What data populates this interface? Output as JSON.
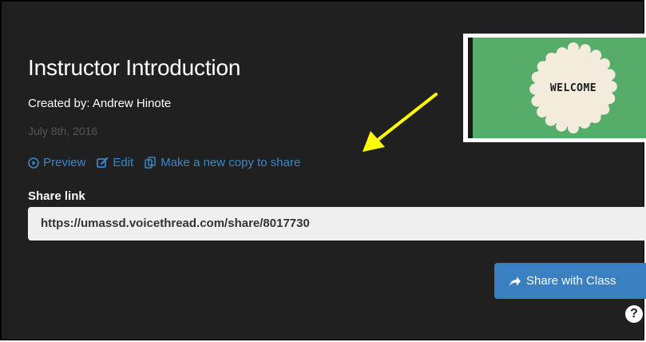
{
  "voicethread": {
    "title": "Instructor Introduction",
    "created_by": "Created by: Andrew Hinote",
    "date": "July 8th, 2016",
    "actions": {
      "preview": "Preview",
      "edit": "Edit",
      "copy": "Make a new copy to share"
    },
    "share_link_label": "Share link",
    "share_link_value": "https://umassd.voicethread.com/share/8017730",
    "share_button": "Share with Class",
    "help_icon": "?",
    "thumbnail_text": "WELCOME"
  },
  "colors": {
    "panel_bg": "#202020",
    "link": "#3a87c8",
    "button": "#3a7fc0",
    "thumbnail_bg": "#56ad6a",
    "badge": "#f3ecdc",
    "arrow": "#ffff00"
  },
  "icons": {
    "preview": "play-circle-icon",
    "edit": "edit-icon",
    "copy": "copy-icon",
    "share": "share-arrow-icon",
    "help": "question-circle-icon"
  }
}
